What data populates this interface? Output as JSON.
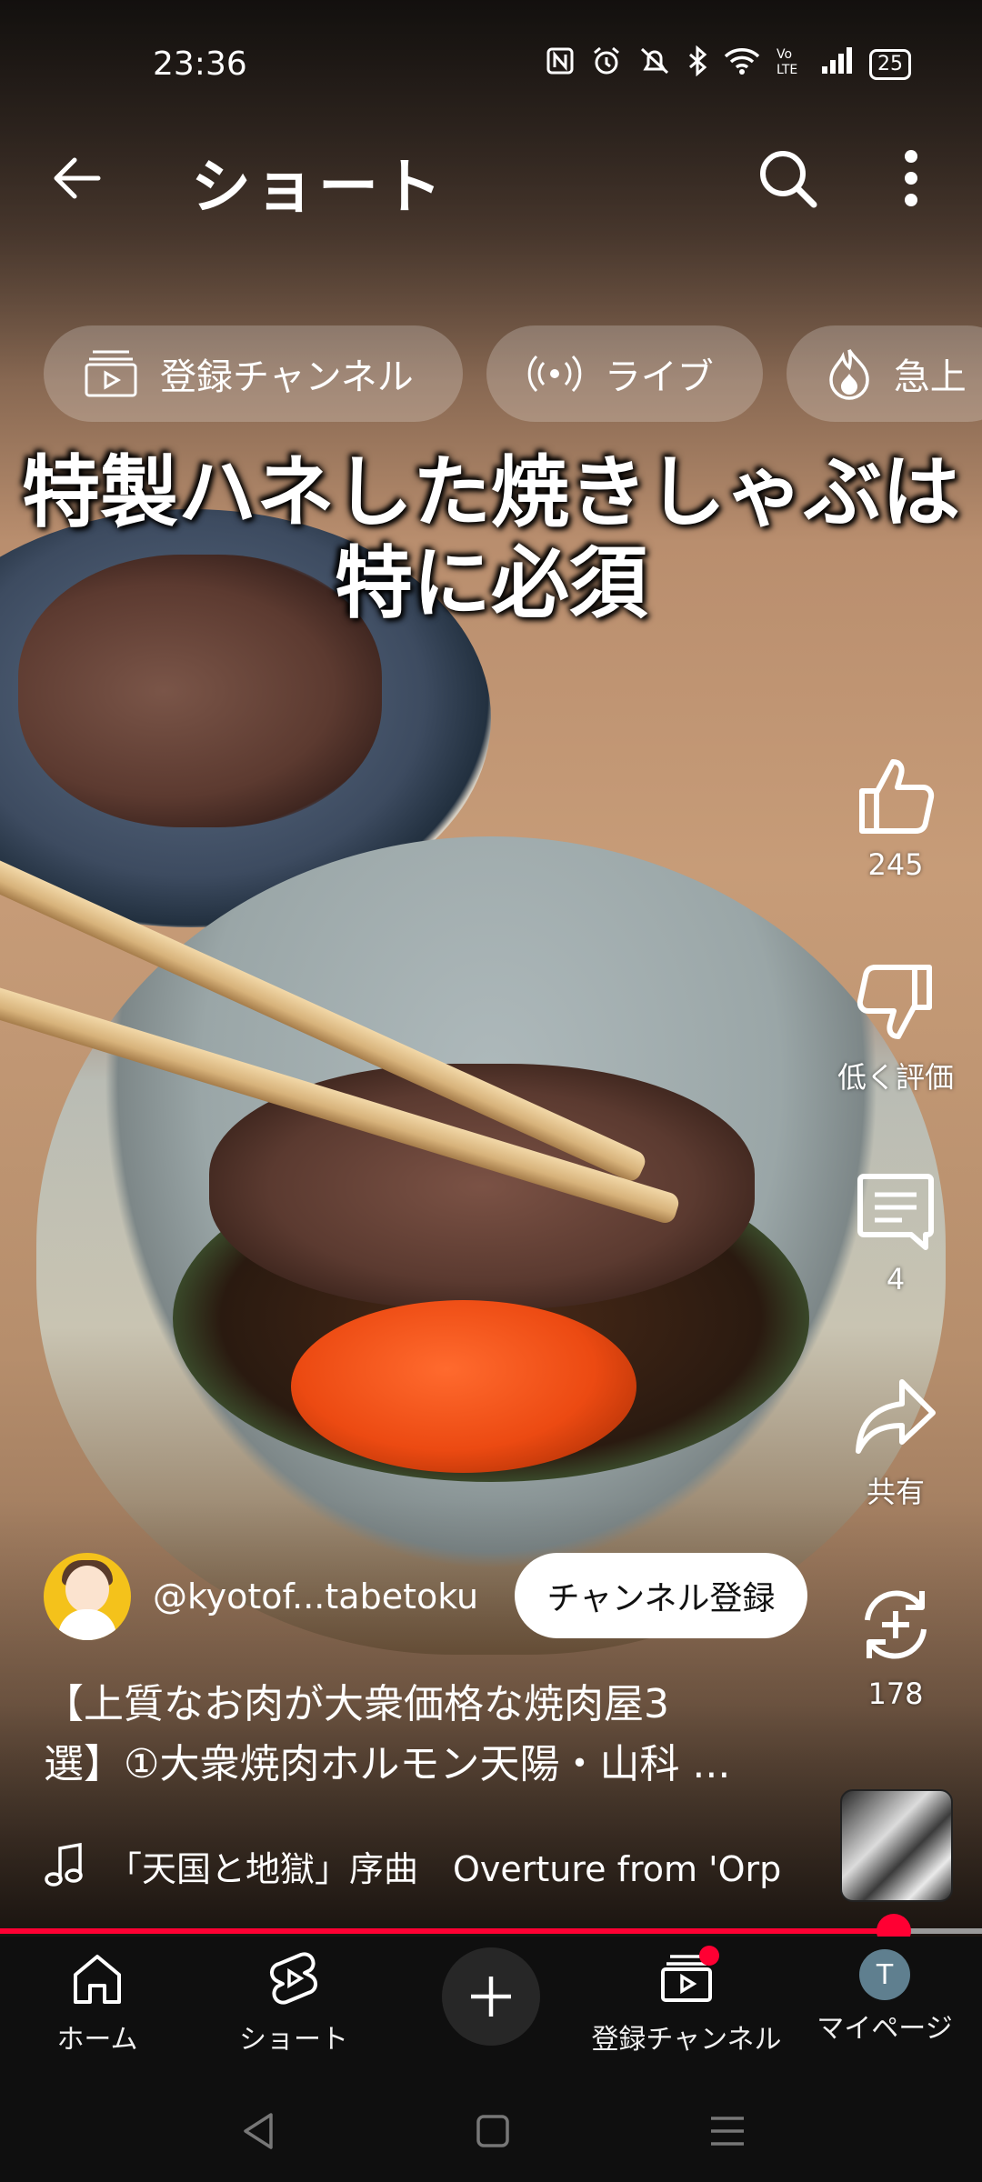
{
  "status_bar": {
    "time": "23:36",
    "battery": "25",
    "icons": [
      "nfc-icon",
      "alarm-icon",
      "mute-icon",
      "bluetooth-icon",
      "wifi-icon",
      "volte-icon",
      "signal-icon",
      "battery-icon"
    ]
  },
  "top_bar": {
    "title": "ショート",
    "icons": [
      "back-arrow-icon",
      "search-icon",
      "more-vert-icon"
    ]
  },
  "chips": [
    {
      "label": "登録チャンネル",
      "icon": "subscriptions-icon"
    },
    {
      "label": "ライブ",
      "icon": "live-icon"
    },
    {
      "label": "急上",
      "icon": "trending-icon"
    }
  ],
  "caption": {
    "line1": "特製ハネした焼きしゃぶは",
    "line2": "特に必須"
  },
  "actions": {
    "like_count": "245",
    "dislike_label": "低く評価",
    "comment_count": "4",
    "share_label": "共有",
    "remix_count": "178"
  },
  "channel": {
    "handle": "@kyotof...tabetoku",
    "subscribe_label": "チャンネル登録"
  },
  "description": {
    "line1": "【上質なお肉が大衆価格な焼肉屋3",
    "line2": "選】①大衆焼肉ホルモン天陽・山科 ..."
  },
  "music": {
    "title": "「天国と地獄」序曲　Overture from 'Orp"
  },
  "progress": {
    "fraction": 0.91
  },
  "bottom_nav": {
    "home": "ホーム",
    "shorts": "ショート",
    "subscriptions": "登録チャンネル",
    "my_page": "マイページ",
    "avatar_letter": "T"
  },
  "colors": {
    "accent": "#ff0033",
    "nav_bg": "#0f0f0f"
  }
}
